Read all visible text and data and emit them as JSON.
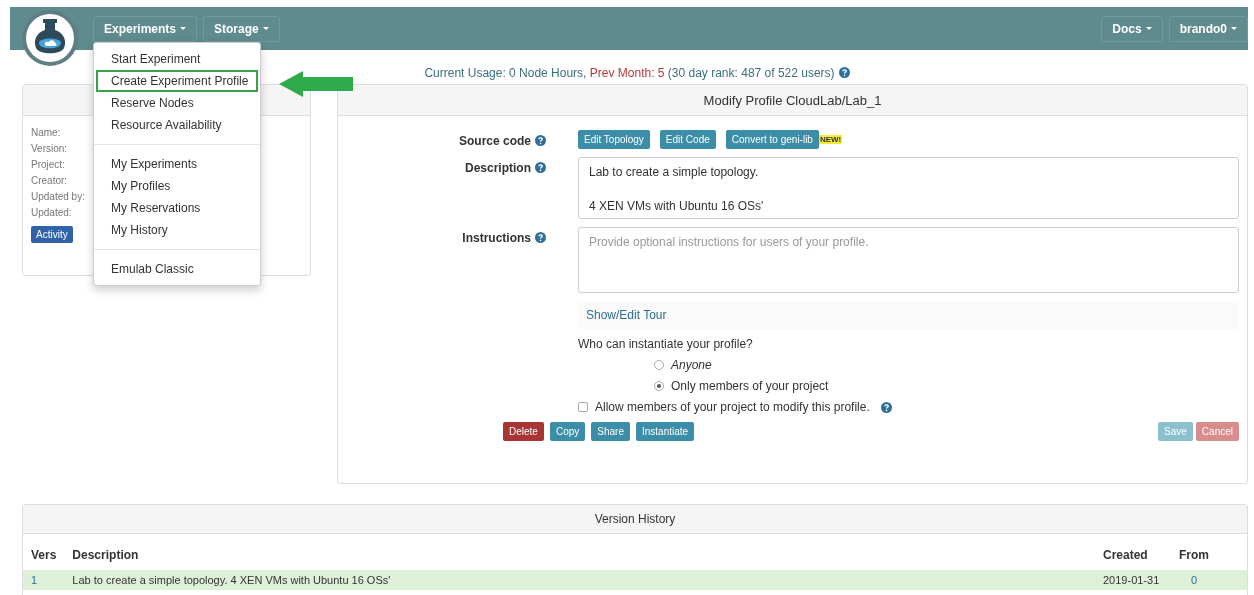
{
  "navbar": {
    "menus": [
      {
        "label": "Experiments"
      },
      {
        "label": "Storage"
      }
    ],
    "right_menus": [
      {
        "label": "Docs"
      },
      {
        "label": "brando0"
      }
    ]
  },
  "experiments_menu": {
    "groups": [
      [
        {
          "label": "Start Experiment",
          "selected": false
        },
        {
          "label": "Create Experiment Profile",
          "selected": true
        },
        {
          "label": "Reserve Nodes",
          "selected": false
        },
        {
          "label": "Resource Availability",
          "selected": false
        }
      ],
      [
        {
          "label": "My Experiments",
          "selected": false
        },
        {
          "label": "My Profiles",
          "selected": false
        },
        {
          "label": "My Reservations",
          "selected": false
        },
        {
          "label": "My History",
          "selected": false
        }
      ],
      [
        {
          "label": "Emulab Classic",
          "selected": false
        }
      ]
    ]
  },
  "usage": {
    "current": "Current Usage: 0 Node Hours,",
    "prev_month": "Prev Month: 5",
    "rank": "(30 day rank: 487 of 522 users)"
  },
  "profile_card": {
    "fields": [
      "Name:",
      "Version:",
      "Project:",
      "Creator:",
      "Updated by:",
      "Updated:"
    ],
    "button": "Activity"
  },
  "modify_panel": {
    "title": "Modify Profile CloudLab/Lab_1",
    "source_code": {
      "label": "Source code",
      "buttons": [
        "Edit Topology",
        "Edit Code",
        "Convert to geni-lib"
      ],
      "badge": "NEW!"
    },
    "description": {
      "label": "Description",
      "lines": [
        "Lab to create a simple topology.",
        "4 XEN VMs with Ubuntu 16 OSs'"
      ]
    },
    "instructions": {
      "label": "Instructions",
      "placeholder": "Provide optional instructions for users of your profile."
    },
    "tour_link": "Show/Edit Tour",
    "who_label": "Who can instantiate your profile?",
    "who_options": [
      {
        "label": "Anyone",
        "selected": false,
        "italic": true
      },
      {
        "label": "Only members of your project",
        "selected": true,
        "italic": false
      }
    ],
    "allow_modify": {
      "label": "Allow members of your project to modify this profile.",
      "checked": false
    },
    "left_buttons": [
      {
        "label": "Delete",
        "kind": "danger",
        "disabled": false
      },
      {
        "label": "Copy",
        "kind": "primary",
        "disabled": false
      },
      {
        "label": "Share",
        "kind": "primary",
        "disabled": false
      },
      {
        "label": "Instantiate",
        "kind": "primary",
        "disabled": false
      }
    ],
    "right_buttons": [
      {
        "label": "Save",
        "kind": "primary",
        "disabled": true
      },
      {
        "label": "Cancel",
        "kind": "danger",
        "disabled": true
      }
    ]
  },
  "version_history": {
    "title": "Version History",
    "columns": [
      "Vers",
      "Description",
      "Created",
      "From"
    ],
    "rows": [
      {
        "vers": "1",
        "description": "Lab to create a simple topology. 4 XEN VMs with Ubuntu 16 OSs'",
        "created": "2019-01-31",
        "from": "0",
        "selected": true
      }
    ]
  }
}
